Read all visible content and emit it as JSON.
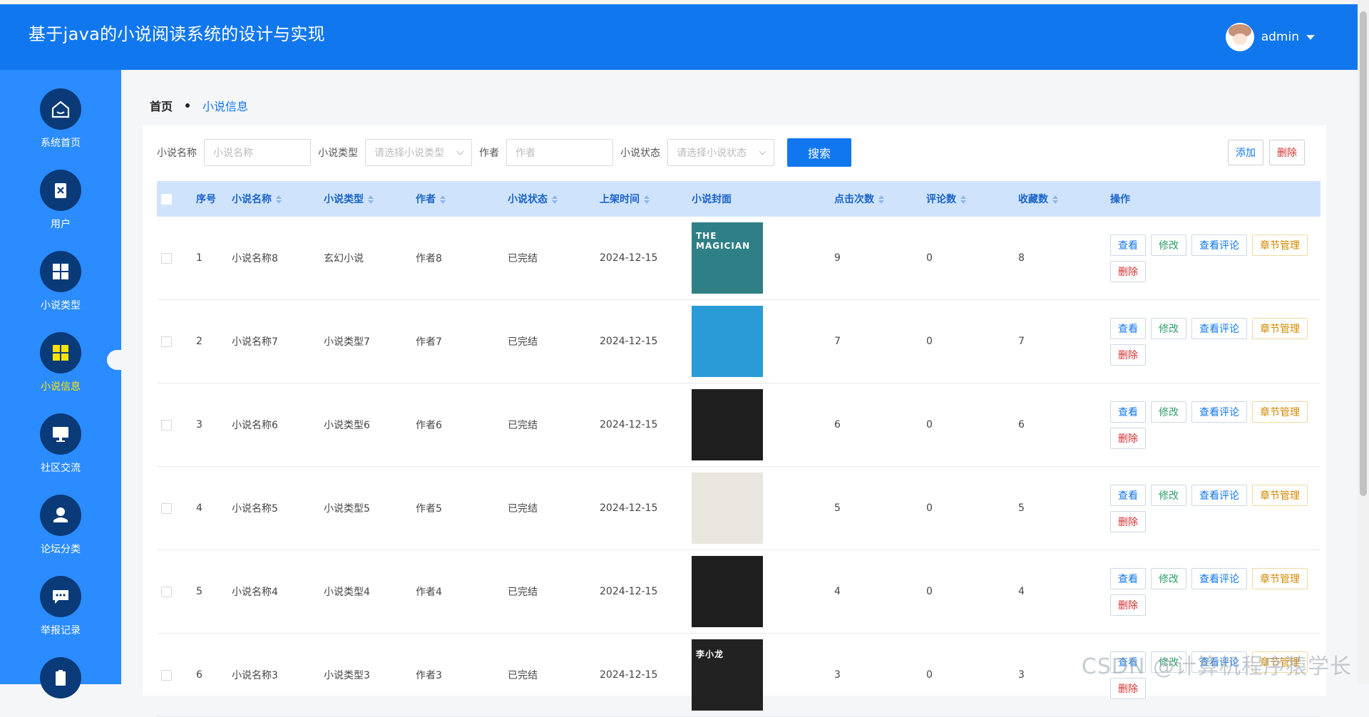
{
  "header": {
    "title": "基于java的小说阅读系统的设计与实现",
    "username": "admin"
  },
  "sidebar": {
    "items": [
      {
        "label": "系统首页",
        "icon": "home-icon"
      },
      {
        "label": "用户",
        "icon": "user-badge-icon"
      },
      {
        "label": "小说类型",
        "icon": "grid-icon"
      },
      {
        "label": "小说信息",
        "icon": "grid-icon",
        "active": true
      },
      {
        "label": "社区交流",
        "icon": "monitor-icon"
      },
      {
        "label": "论坛分类",
        "icon": "person-icon"
      },
      {
        "label": "举报记录",
        "icon": "chat-icon"
      }
    ]
  },
  "breadcrumb": {
    "home": "首页",
    "current": "小说信息"
  },
  "filters": {
    "name_label": "小说名称",
    "name_placeholder": "小说名称",
    "type_label": "小说类型",
    "type_placeholder": "请选择小说类型",
    "author_label": "作者",
    "author_placeholder": "作者",
    "status_label": "小说状态",
    "status_placeholder": "请选择小说状态",
    "search_label": "搜索"
  },
  "actions": {
    "add": "添加",
    "delete": "删除"
  },
  "table": {
    "columns": [
      "序号",
      "小说名称",
      "小说类型",
      "作者",
      "小说状态",
      "上架时间",
      "小说封面",
      "点击次数",
      "评论数",
      "收藏数",
      "操作"
    ],
    "op_labels": {
      "view": "查看",
      "edit": "修改",
      "comments": "查看评论",
      "chapters": "章节管理",
      "delete": "删除"
    },
    "rows": [
      {
        "index": "1",
        "name": "小说名称8",
        "type": "玄幻小说",
        "author": "作者8",
        "status": "已完结",
        "date": "2024-12-15",
        "clicks": "9",
        "comments": "0",
        "favorites": "8",
        "cover_text": "THE MAGICIAN",
        "cover_color": "#2f7f86"
      },
      {
        "index": "2",
        "name": "小说名称7",
        "type": "小说类型7",
        "author": "作者7",
        "status": "已完结",
        "date": "2024-12-15",
        "clicks": "7",
        "comments": "0",
        "favorites": "7",
        "cover_text": "",
        "cover_color": "#2a9bd6"
      },
      {
        "index": "3",
        "name": "小说名称6",
        "type": "小说类型6",
        "author": "作者6",
        "status": "已完结",
        "date": "2024-12-15",
        "clicks": "6",
        "comments": "0",
        "favorites": "6",
        "cover_text": "",
        "cover_color": "#1e1e1e"
      },
      {
        "index": "4",
        "name": "小说名称5",
        "type": "小说类型5",
        "author": "作者5",
        "status": "已完结",
        "date": "2024-12-15",
        "clicks": "5",
        "comments": "0",
        "favorites": "5",
        "cover_text": "",
        "cover_color": "#e9e6df"
      },
      {
        "index": "5",
        "name": "小说名称4",
        "type": "小说类型4",
        "author": "作者4",
        "status": "已完结",
        "date": "2024-12-15",
        "clicks": "4",
        "comments": "0",
        "favorites": "4",
        "cover_text": "",
        "cover_color": "#1e1e1e"
      },
      {
        "index": "6",
        "name": "小说名称3",
        "type": "小说类型3",
        "author": "作者3",
        "status": "已完结",
        "date": "2024-12-15",
        "clicks": "3",
        "comments": "0",
        "favorites": "3",
        "cover_text": "李小龙",
        "cover_color": "#222222"
      }
    ]
  },
  "watermark": "CSDN @计算机程序猿学长",
  "colors": {
    "primary": "#1177ee",
    "sidebar": "#2a8cff",
    "icon_bg": "#0a3a78",
    "active_label": "#ffe300",
    "header_row": "#cfe4fc"
  }
}
